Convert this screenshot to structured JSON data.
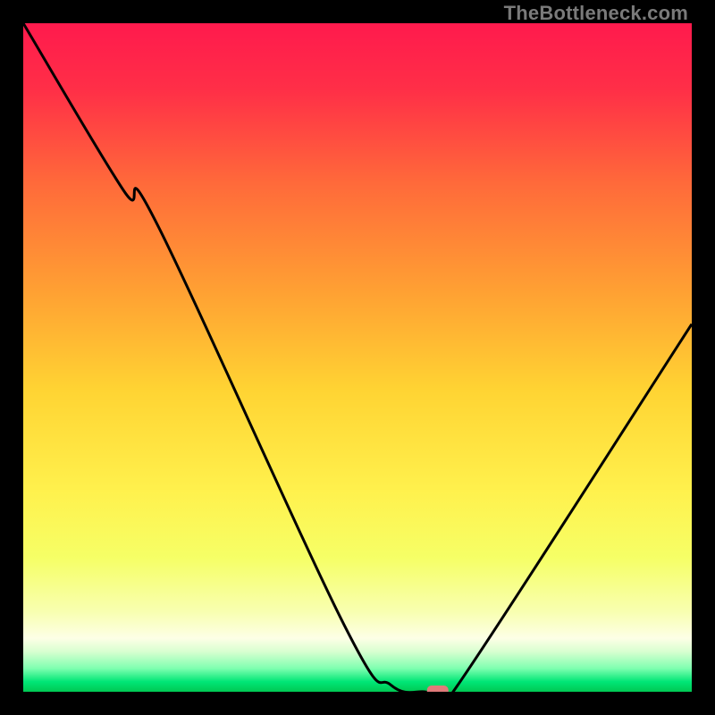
{
  "watermark": "TheBottleneck.com",
  "chart_data": {
    "type": "line",
    "title": "",
    "xlabel": "",
    "ylabel": "",
    "xlim": [
      0,
      100
    ],
    "ylim": [
      0,
      100
    ],
    "series": [
      {
        "name": "bottleneck-curve",
        "x": [
          0,
          15,
          20,
          48,
          55,
          60,
          62,
          65,
          100
        ],
        "values": [
          100,
          75,
          70,
          10,
          1,
          0,
          0,
          1,
          55
        ]
      }
    ],
    "marker": {
      "x": 62,
      "y": 0
    },
    "background_gradient_stops": [
      {
        "pos": 0.0,
        "color": "#ff1a4d"
      },
      {
        "pos": 0.1,
        "color": "#ff2f47"
      },
      {
        "pos": 0.24,
        "color": "#ff6a3a"
      },
      {
        "pos": 0.4,
        "color": "#ffa033"
      },
      {
        "pos": 0.55,
        "color": "#ffd433"
      },
      {
        "pos": 0.7,
        "color": "#fff14d"
      },
      {
        "pos": 0.8,
        "color": "#f6ff66"
      },
      {
        "pos": 0.88,
        "color": "#f8ffb0"
      },
      {
        "pos": 0.92,
        "color": "#fdffe6"
      },
      {
        "pos": 0.94,
        "color": "#d8ffd0"
      },
      {
        "pos": 0.965,
        "color": "#7fffb0"
      },
      {
        "pos": 0.985,
        "color": "#00e676"
      },
      {
        "pos": 1.0,
        "color": "#00c853"
      }
    ],
    "marker_color": "#e07a7a",
    "curve_color": "#000000"
  }
}
